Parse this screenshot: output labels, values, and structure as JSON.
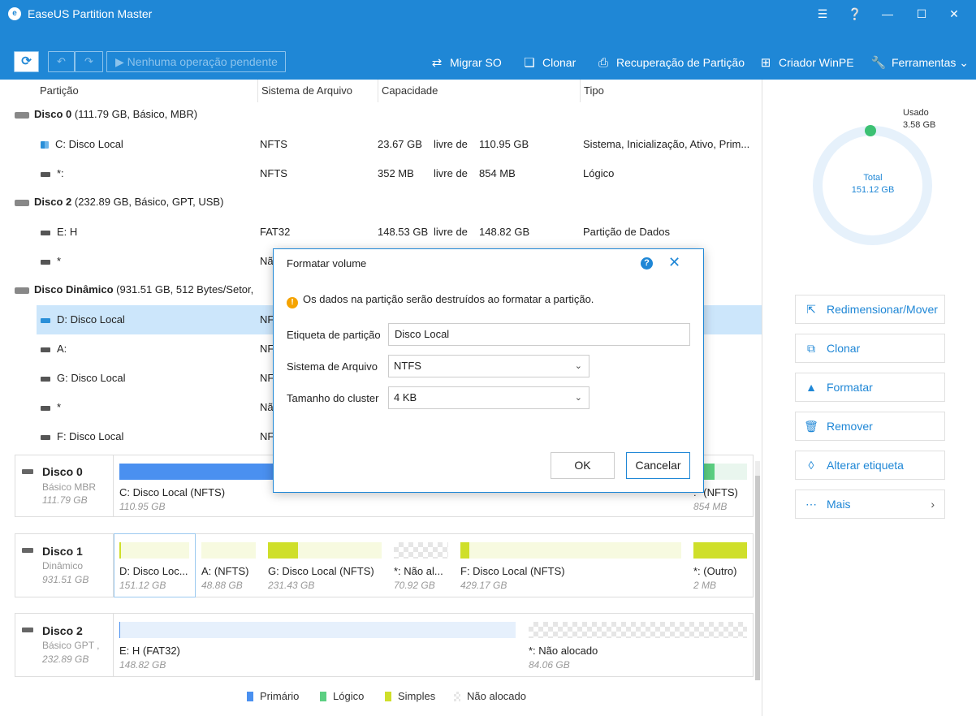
{
  "app": {
    "title": "EaseUS Partition Master"
  },
  "toolbar": {
    "pending_label": "Nenhuma operação pendente",
    "tools": [
      "Migrar SO",
      "Clonar",
      "Recuperação de Partição",
      "Criador WinPE",
      "Ferramentas"
    ]
  },
  "columns": [
    "Partição",
    "Sistema de Arquivo",
    "Capacidade",
    "Tipo"
  ],
  "table": {
    "disks": [
      {
        "name": "Disco 0",
        "info": "(111.79 GB, Básico, MBR)"
      },
      {
        "name": "Disco 2",
        "info": "(232.89 GB, Básico, GPT, USB)"
      },
      {
        "name": "Disco Dinâmico",
        "info": "(931.51 GB, 512 Bytes/Setor,"
      }
    ],
    "rows": [
      {
        "name": "C: Disco Local",
        "fs": "NFTS",
        "used": "23.67 GB",
        "free_of": "livre de",
        "total": "110.95 GB",
        "type": "Sistema, Inicialização, Ativo, Prim..."
      },
      {
        "name": "*:",
        "fs": "NFTS",
        "used": "352 MB",
        "free_of": "livre de",
        "total": "854 MB",
        "type": "Lógico"
      },
      {
        "name": "E: H",
        "fs": "FAT32",
        "used": "148.53 GB",
        "free_of": "livre de",
        "total": "148.82 GB",
        "type": "Partição de Dados"
      },
      {
        "name": "*",
        "fs": "Nã",
        "used": "",
        "free_of": "",
        "total": "",
        "type": ""
      },
      {
        "name": "D: Disco Local",
        "fs": "NF",
        "used": "",
        "free_of": "",
        "total": "",
        "type": ""
      },
      {
        "name": "A:",
        "fs": "NF",
        "used": "",
        "free_of": "",
        "total": "",
        "type": ""
      },
      {
        "name": "G: Disco Local",
        "fs": "NF",
        "used": "",
        "free_of": "",
        "total": "",
        "type": ""
      },
      {
        "name": "*",
        "fs": "Nã",
        "used": "",
        "free_of": "",
        "total": "",
        "type": ""
      },
      {
        "name": "F: Disco Local",
        "fs": "NF",
        "used": "",
        "free_of": "",
        "total": "",
        "type": ""
      }
    ]
  },
  "map": {
    "disk0": {
      "name": "Disco 0",
      "sub": "Básico MBR",
      "size": "111.79 GB",
      "segs": [
        {
          "label": "C: Disco Local (NFTS)",
          "size": "110.95 GB",
          "fill": 1.0
        },
        {
          "label": ":* (NFTS)",
          "size": "854 MB",
          "fill": 0.4
        }
      ]
    },
    "disk1": {
      "name": "Disco 1",
      "sub": "Dinâmico",
      "size": "931.51 GB",
      "segs": [
        {
          "label": "D: Disco Loc...",
          "size": "151.12 GB",
          "fill": 0.02
        },
        {
          "label": "A:  (NFTS)",
          "size": "48.88 GB",
          "fill": 0.0
        },
        {
          "label": "G: Disco Local (NFTS)",
          "size": "231.43 GB",
          "fill": 0.27
        },
        {
          "label": "*: Não al...",
          "size": "70.92 GB",
          "fill": 0
        },
        {
          "label": "F: Disco Local (NFTS)",
          "size": "429.17 GB",
          "fill": 0.04
        },
        {
          "label": "*:  (Outro)",
          "size": "2 MB",
          "fill": 1.0
        }
      ]
    },
    "disk2": {
      "name": "Disco 2",
      "sub": "Básico GPT ,",
      "size": "232.89 GB",
      "segs": [
        {
          "label": "E: H (FAT32)",
          "size": "148.82 GB",
          "fill": 0.0
        },
        {
          "label": "*: Não alocado",
          "size": "84.06 GB",
          "fill": 0
        }
      ]
    }
  },
  "legend": [
    "Primário",
    "Lógico",
    "Simples",
    "Não alocado"
  ],
  "colors": {
    "primary": "#4a90f0",
    "logical": "#5ccf82",
    "simple": "#cfdf2a",
    "accent": "#1f87d6"
  },
  "usage": {
    "used_label": "Usado",
    "used_value": "3.58 GB",
    "used_fraction": 0.024,
    "total_label": "Total",
    "total_value": "151.12 GB"
  },
  "actions": [
    "Redimensionar/Mover",
    "Clonar",
    "Formatar",
    "Remover",
    "Alterar etiqueta",
    "Mais"
  ],
  "dialog": {
    "title": "Formatar volume",
    "warning": "Os dados na partição serão destruídos ao formatar a partição.",
    "label_field": "Etiqueta de partição",
    "label_value": "Disco Local",
    "fs_field": "Sistema de Arquivo",
    "fs_value": "NTFS",
    "cluster_field": "Tamanho do cluster",
    "cluster_value": "4 KB",
    "ok": "OK",
    "cancel": "Cancelar"
  }
}
